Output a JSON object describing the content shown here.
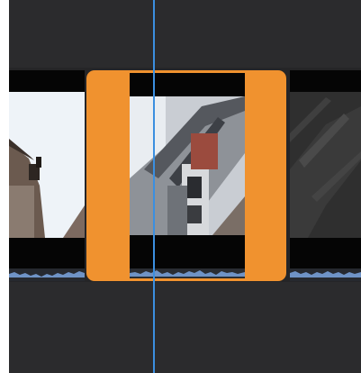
{
  "timeline": {
    "background_color": "#2b2b2d",
    "track_color": "#252527",
    "playhead_color": "#3b8fe0"
  },
  "clips": [
    {
      "name": "clip-left",
      "thumbnail": "building-roof-against-sky",
      "selected": false
    },
    {
      "name": "clip-selected",
      "thumbnail": "bridge-underside-pillar",
      "selected": true,
      "trim_handle_color": "#f0922f"
    },
    {
      "name": "clip-right",
      "thumbnail": "dark-bridge-underside",
      "selected": false
    }
  ],
  "audio_waveform_color": "#6f93c6"
}
